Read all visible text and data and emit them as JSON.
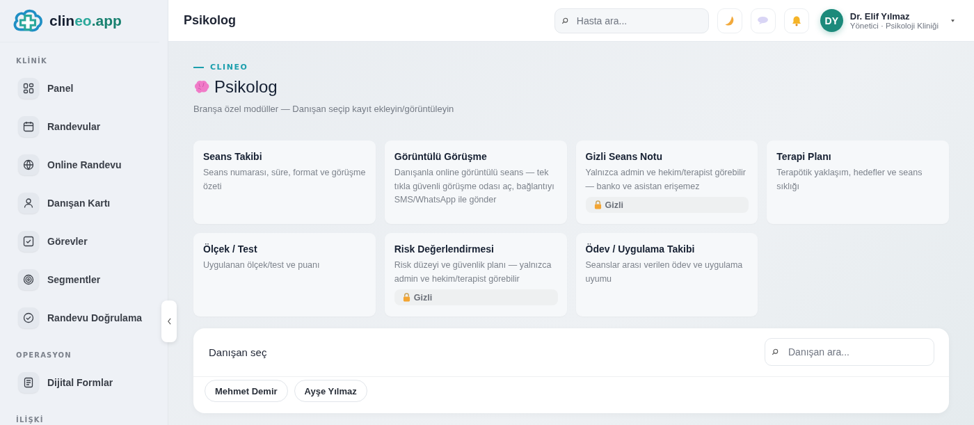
{
  "brand": {
    "name_part_1": "clin",
    "name_part_2": "eo",
    "name_part_3": ".app"
  },
  "sidebar": {
    "sections": [
      {
        "title": "KLİNİK",
        "items": [
          {
            "label": "Panel"
          },
          {
            "label": "Randevular"
          },
          {
            "label": "Online Randevu"
          },
          {
            "label": "Danışan Kartı"
          },
          {
            "label": "Görevler"
          },
          {
            "label": "Segmentler"
          },
          {
            "label": "Randevu Doğrulama"
          }
        ]
      },
      {
        "title": "OPERASYON",
        "items": [
          {
            "label": "Dijital Formlar"
          }
        ]
      },
      {
        "title": "İLİŞKİ"
      }
    ]
  },
  "header": {
    "title": "Psikolog",
    "search": {
      "placeholder": "Hasta ara..."
    },
    "user": {
      "initials": "DY",
      "name": "Dr. Elif Yılmaz",
      "role": "Yönetici · Psikoloji Kliniği"
    }
  },
  "page": {
    "eyebrow": "CLINEO",
    "title": "Psikolog",
    "subtitle": "Branşa özel modüller — Danışan seçip kayıt ekleyin/görüntüleyin"
  },
  "modules": [
    {
      "title": "Seans Takibi",
      "description": "Seans numarası, süre, format ve görüşme özeti"
    },
    {
      "title": "Görüntülü Görüşme",
      "description": "Danışanla online görüntülü seans — tek tıkla güvenli görüşme odası aç, bağlantıyı SMS/WhatsApp ile gönder"
    },
    {
      "title": "Gizli Seans Notu",
      "description": "Yalnızca admin ve hekim/terapist görebilir — banko ve asistan erişemez",
      "badge": "Gizli"
    },
    {
      "title": "Terapi Planı",
      "description": "Terapötik yaklaşım, hedefler ve seans sıklığı"
    },
    {
      "title": "Ölçek / Test",
      "description": "Uygulanan ölçek/test ve puanı"
    },
    {
      "title": "Risk Değerlendirmesi",
      "description": "Risk düzeyi ve güvenlik planı — yalnızca admin ve hekim/terapist görebilir",
      "badge": "Gizli"
    },
    {
      "title": "Ödev / Uygulama Takibi",
      "description": "Seanslar arası verilen ödev ve uygulama uyumu"
    }
  ],
  "client_picker": {
    "title": "Danışan seç",
    "search": {
      "placeholder": "Danışan ara..."
    },
    "clients": [
      {
        "name": "Mehmet Demir"
      },
      {
        "name": "Ayşe Yılmaz"
      }
    ]
  }
}
